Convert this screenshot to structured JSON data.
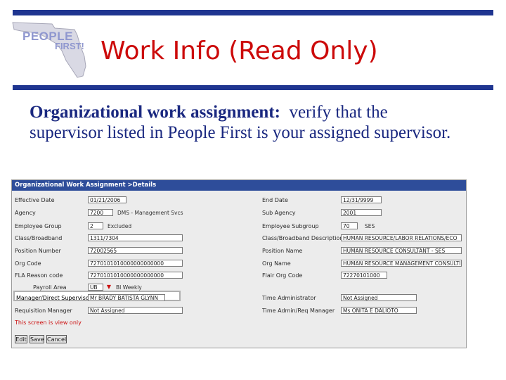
{
  "slide": {
    "title": "Work Info (Read Only)",
    "heading": "Organizational work assignment:",
    "body": "  verify that the supervisor listed in People First is your assigned supervisor."
  },
  "logo": {
    "line1": "PEOPLE",
    "line2": "FIRST!"
  },
  "colors": {
    "bar": "#1f3590",
    "title": "#cc0a0a",
    "text": "#1a2880",
    "panel_header": "#2e4d9a"
  },
  "screen": {
    "header": "Organizational Work Assignment >Details",
    "left": [
      {
        "label": "Effective Date",
        "value": "01/21/2006",
        "extra": ""
      },
      {
        "label": "Agency",
        "value": "7200",
        "extra": "DMS - Management Svcs"
      },
      {
        "label": "Employee Group",
        "value": "2",
        "extra": "Excluded"
      },
      {
        "label": "Class/Broadband",
        "value": "1311/7304",
        "extra": ""
      },
      {
        "label": "Position Number",
        "value": "72002565",
        "extra": ""
      },
      {
        "label": "Org Code",
        "value": "7270101010000000000000",
        "extra": ""
      },
      {
        "label": "FLA Reason code",
        "value": "7270101010000000000000",
        "extra": ""
      },
      {
        "label": "Payroll Area",
        "value": "UB",
        "extra": "BI Weekly"
      },
      {
        "label": "Manager/Direct Supervisor",
        "value": "Mr BRADY BATISTA GLYNN",
        "extra": ""
      },
      {
        "label": "Requisition Manager",
        "value": "Not Assigned",
        "extra": ""
      }
    ],
    "right": [
      {
        "label": "End Date",
        "value": "12/31/9999"
      },
      {
        "label": "Sub Agency",
        "value": "2001"
      },
      {
        "label": "Employee Subgroup",
        "value": "70",
        "extra": "SES"
      },
      {
        "label": "Class/Broadband Description",
        "value": "HUMAN RESOURCE/LABOR RELATIONS/ECO"
      },
      {
        "label": "Position Name",
        "value": "HUMAN RESOURCE CONSULTANT - SES"
      },
      {
        "label": "Org Name",
        "value": "HUMAN RESOURCE MANAGEMENT CONSULTING"
      },
      {
        "label": "Flair Org Code",
        "value": "72270101000"
      },
      {
        "label": "Time Administrator",
        "value": "Not Assigned"
      },
      {
        "label": "Time Admin/Req Manager",
        "value": "Ms ONITA E DALIOTO"
      }
    ],
    "readonly_note": "This screen is view only",
    "buttons": [
      "Edit",
      "Save",
      "Cancel"
    ]
  }
}
